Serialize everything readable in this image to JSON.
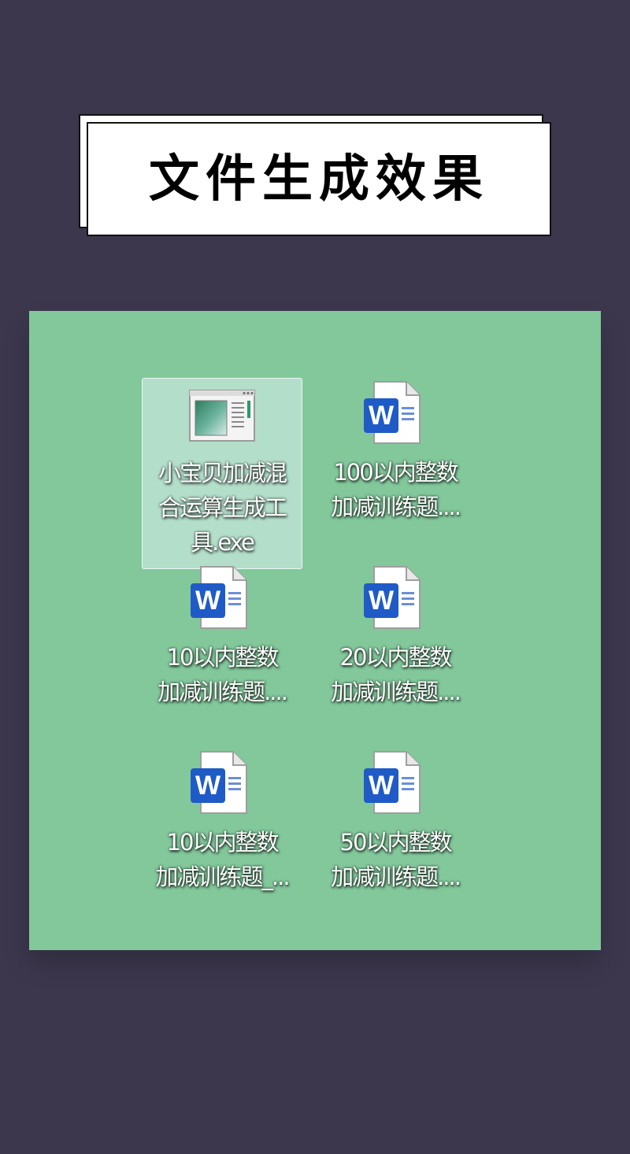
{
  "title": "文件生成效果",
  "colors": {
    "background": "#3c374d",
    "desktop": "#82c89b",
    "word_blue": "#1f5bc6"
  },
  "files": [
    {
      "icon": "exe-app-icon",
      "lines": [
        "小宝贝加减混",
        "合运算生成工",
        "具.exe"
      ],
      "selected": true
    },
    {
      "icon": "word-doc-icon",
      "badge": "W",
      "lines": [
        "100以内整数",
        "加减训练题...."
      ]
    },
    {
      "icon": "word-doc-icon",
      "badge": "W",
      "lines": [
        "10以内整数",
        "加减训练题...."
      ]
    },
    {
      "icon": "word-doc-icon",
      "badge": "W",
      "lines": [
        "20以内整数",
        "加减训练题...."
      ]
    },
    {
      "icon": "word-doc-icon",
      "badge": "W",
      "lines": [
        "10以内整数",
        "加减训练题_..."
      ]
    },
    {
      "icon": "word-doc-icon",
      "badge": "W",
      "lines": [
        "50以内整数",
        "加减训练题...."
      ]
    }
  ]
}
